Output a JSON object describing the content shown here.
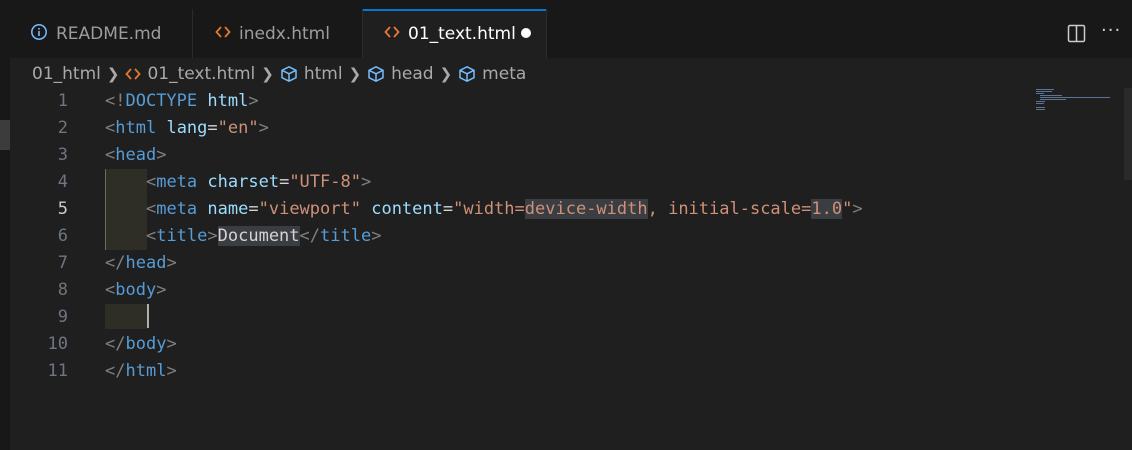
{
  "tabs": [
    {
      "label": "README.md",
      "icon": "info-icon",
      "active": false
    },
    {
      "label": "inedx.html",
      "icon": "html-code-icon",
      "active": false
    },
    {
      "label": "01_text.html",
      "icon": "html-code-icon",
      "active": true,
      "modified": true
    }
  ],
  "tab_actions": {
    "split": "split-editor-icon",
    "more": "···"
  },
  "breadcrumbs": [
    {
      "label": "01_html",
      "icon": ""
    },
    {
      "label": "01_text.html",
      "icon": "html-code-icon"
    },
    {
      "label": "html",
      "icon": "symbol-cube-icon"
    },
    {
      "label": "head",
      "icon": "symbol-cube-icon"
    },
    {
      "label": "meta",
      "icon": "symbol-cube-icon"
    }
  ],
  "editor": {
    "current_line": 5,
    "lines": [
      {
        "n": "1",
        "tokens": [
          {
            "t": "<!",
            "c": "b"
          },
          {
            "t": "DOCTYPE",
            "c": "tg"
          },
          {
            "t": " ",
            "c": "tx"
          },
          {
            "t": "html",
            "c": "at"
          },
          {
            "t": ">",
            "c": "b"
          }
        ]
      },
      {
        "n": "2",
        "tokens": [
          {
            "t": "<",
            "c": "b"
          },
          {
            "t": "html",
            "c": "tg"
          },
          {
            "t": " ",
            "c": "tx"
          },
          {
            "t": "lang",
            "c": "at"
          },
          {
            "t": "=",
            "c": "tx"
          },
          {
            "t": "\"en\"",
            "c": "st"
          },
          {
            "t": ">",
            "c": "b"
          }
        ]
      },
      {
        "n": "3",
        "tokens": [
          {
            "t": "<",
            "c": "b"
          },
          {
            "t": "head",
            "c": "tg"
          },
          {
            "t": ">",
            "c": "b"
          }
        ]
      },
      {
        "n": "4",
        "tokens": [
          {
            "t": "    ",
            "c": "tx"
          },
          {
            "t": "<",
            "c": "b"
          },
          {
            "t": "meta",
            "c": "tg"
          },
          {
            "t": " ",
            "c": "tx"
          },
          {
            "t": "charset",
            "c": "at"
          },
          {
            "t": "=",
            "c": "tx"
          },
          {
            "t": "\"UTF-8\"",
            "c": "st"
          },
          {
            "t": ">",
            "c": "b"
          }
        ]
      },
      {
        "n": "5",
        "tokens": [
          {
            "t": "    ",
            "c": "tx"
          },
          {
            "t": "<",
            "c": "b"
          },
          {
            "t": "meta",
            "c": "tg"
          },
          {
            "t": " ",
            "c": "tx"
          },
          {
            "t": "name",
            "c": "at"
          },
          {
            "t": "=",
            "c": "tx"
          },
          {
            "t": "\"viewport\"",
            "c": "st"
          },
          {
            "t": " ",
            "c": "tx"
          },
          {
            "t": "content",
            "c": "at"
          },
          {
            "t": "=",
            "c": "tx"
          },
          {
            "t": "\"width=",
            "c": "st"
          },
          {
            "t": "device-width",
            "c": "st hl"
          },
          {
            "t": ", initial-scale=",
            "c": "st"
          },
          {
            "t": "1.0",
            "c": "st hl"
          },
          {
            "t": "\"",
            "c": "st"
          },
          {
            "t": ">",
            "c": "b"
          }
        ]
      },
      {
        "n": "6",
        "tokens": [
          {
            "t": "    ",
            "c": "tx"
          },
          {
            "t": "<",
            "c": "b"
          },
          {
            "t": "title",
            "c": "tg"
          },
          {
            "t": ">",
            "c": "b"
          },
          {
            "t": "Document",
            "c": "tx hl"
          },
          {
            "t": "</",
            "c": "b"
          },
          {
            "t": "title",
            "c": "tg"
          },
          {
            "t": ">",
            "c": "b"
          }
        ]
      },
      {
        "n": "7",
        "tokens": [
          {
            "t": "</",
            "c": "b"
          },
          {
            "t": "head",
            "c": "tg"
          },
          {
            "t": ">",
            "c": "b"
          }
        ]
      },
      {
        "n": "8",
        "tokens": [
          {
            "t": "<",
            "c": "b"
          },
          {
            "t": "body",
            "c": "tg"
          },
          {
            "t": ">",
            "c": "b"
          }
        ]
      },
      {
        "n": "9",
        "tokens": []
      },
      {
        "n": "10",
        "tokens": [
          {
            "t": "</",
            "c": "b"
          },
          {
            "t": "body",
            "c": "tg"
          },
          {
            "t": ">",
            "c": "b"
          }
        ]
      },
      {
        "n": "11",
        "tokens": [
          {
            "t": "</",
            "c": "b"
          },
          {
            "t": "html",
            "c": "tg"
          },
          {
            "t": ">",
            "c": "b"
          }
        ]
      }
    ]
  },
  "colors": {
    "accent": "#0078d4",
    "tag": "#569cd6",
    "attr": "#9cdcfe",
    "string": "#ce9178",
    "html_icon": "#e37933",
    "info_icon": "#75beff"
  }
}
